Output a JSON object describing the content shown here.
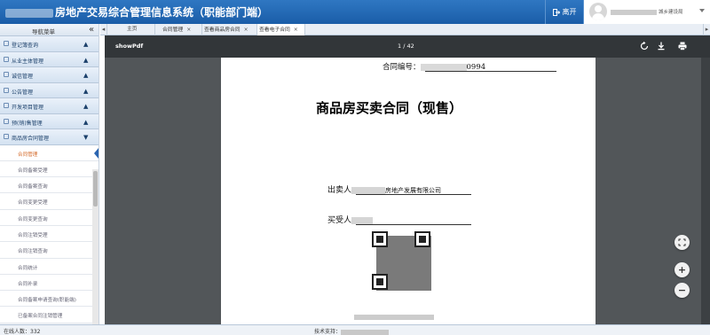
{
  "header": {
    "title": "房地产交易综合管理信息系统（职能部门端）",
    "logout_label": "离开",
    "user_name": "城乡建设局"
  },
  "sidebar": {
    "title": "导航菜单",
    "collapse_icon": "«",
    "menus": [
      {
        "label": "登记簿查询",
        "chevron": "▲"
      },
      {
        "label": "从业主体管理",
        "chevron": "▲"
      },
      {
        "label": "诚信管理",
        "chevron": "▲"
      },
      {
        "label": "公告管理",
        "chevron": "▲"
      },
      {
        "label": "开发项目管理",
        "chevron": "▲"
      },
      {
        "label": "预(销)售管理",
        "chevron": "▲"
      },
      {
        "label": "商品房合同管理",
        "chevron": "▼"
      }
    ],
    "sub_items": [
      "合同管理",
      "合同备案受理",
      "合同备案查询",
      "合同变更受理",
      "合同变更查询",
      "合同注销受理",
      "合同注销查询",
      "合同统计",
      "合同补录",
      "合同备案申请查询(职能端)",
      "已备案合同注销管理"
    ]
  },
  "tabs": {
    "left_arrow": "◂",
    "right_arrow": "▸",
    "items": [
      {
        "label": "主页",
        "closable": false
      },
      {
        "label": "合同管理",
        "closable": true
      },
      {
        "label": "查看商品房合同",
        "closable": true
      },
      {
        "label": "查看电子合同",
        "closable": true
      }
    ],
    "close_glyph": "×"
  },
  "viewer": {
    "file_name": "showPdf",
    "page_indicator": "1 / 42",
    "toolbar_icons": [
      "rotate-icon",
      "download-icon",
      "print-icon"
    ],
    "zoom_controls": {
      "fit": "fit-page-icon",
      "zoom_in": "+",
      "zoom_out": "−"
    }
  },
  "document": {
    "contract_no_label": "合同编号：",
    "contract_no_suffix": "0994",
    "title": "商品房买卖合同（现售）",
    "seller_label": "出卖人",
    "seller_value": "房地产发展有限公司",
    "buyer_label": "买受人"
  },
  "statusbar": {
    "online_label": "在线人数：",
    "online_count": "332",
    "tech_label": "技术支持："
  },
  "colors": {
    "header_blue": "#1f66b3",
    "pdf_toolbar": "#323639",
    "pdf_background": "#525659",
    "active_sub_item": "#d46a2a"
  }
}
